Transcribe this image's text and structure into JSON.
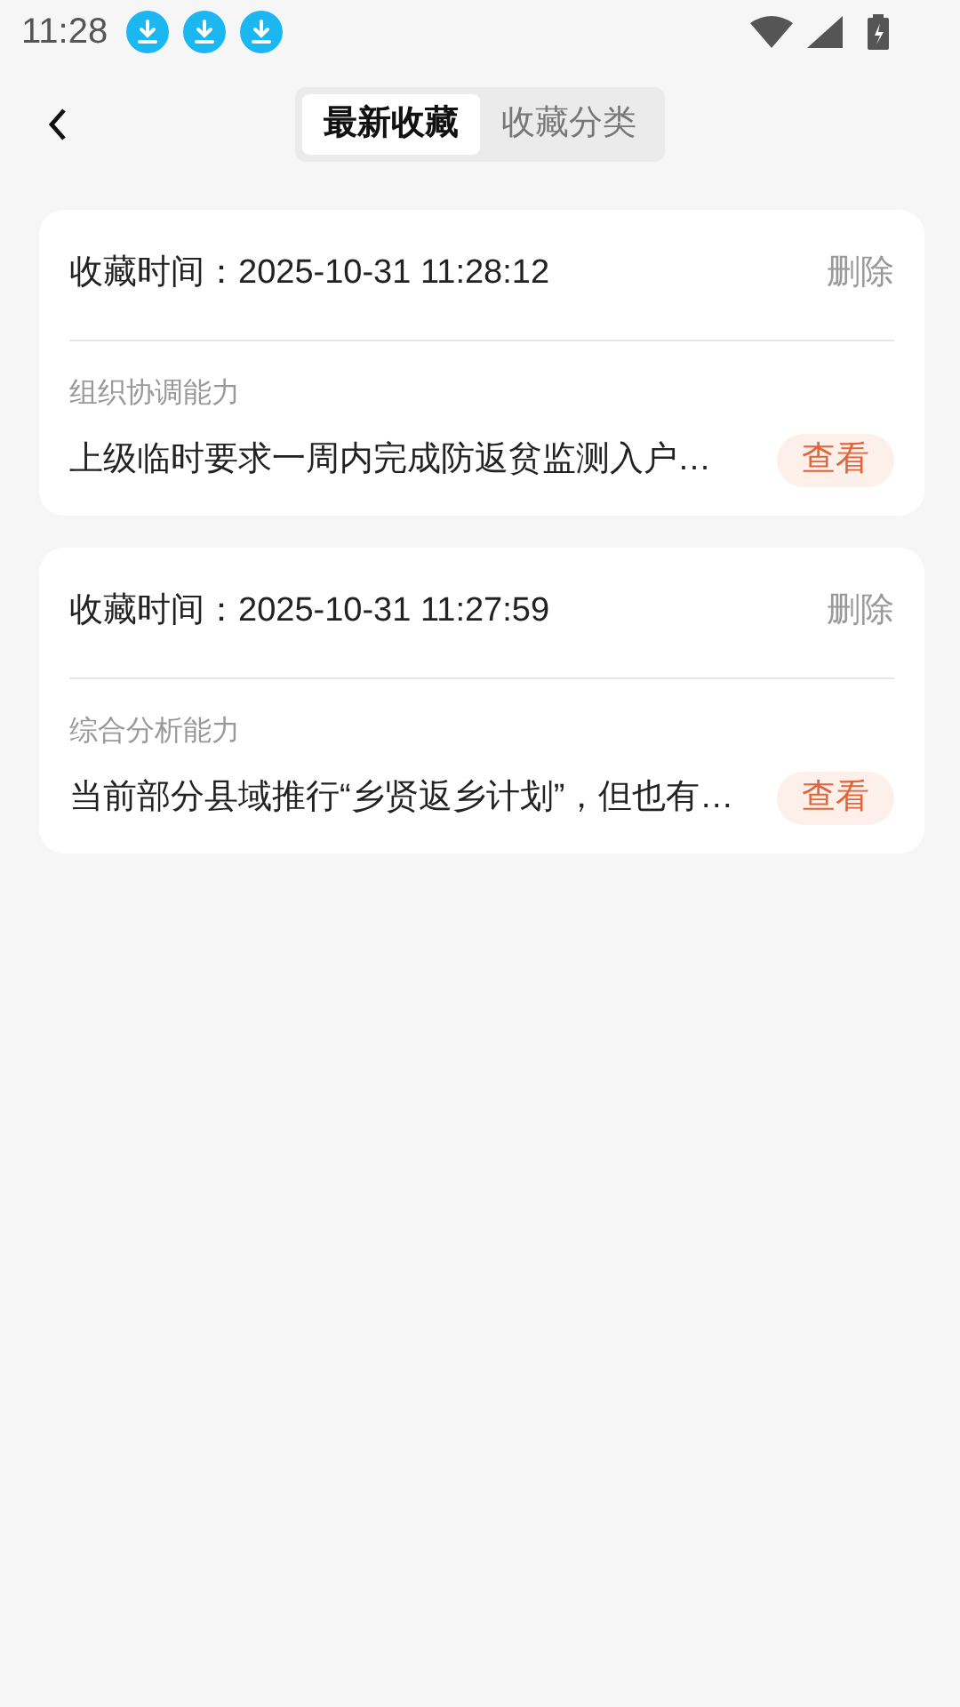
{
  "status_bar": {
    "time": "11:28",
    "notifications": [
      {
        "kind": "download"
      },
      {
        "kind": "download"
      },
      {
        "kind": "download"
      }
    ]
  },
  "tabs": [
    {
      "label": "最新收藏",
      "selected": true
    },
    {
      "label": "收藏分类",
      "selected": false
    }
  ],
  "favorites": [
    {
      "time_label": "收藏时间：2025-10-31 11:28:12",
      "delete": "删除",
      "category": "组织协调能力",
      "excerpt": "上级临时要求一周内完成防返贫监测入户…",
      "view": "查看"
    },
    {
      "time_label": "收藏时间：2025-10-31 11:27:59",
      "delete": "删除",
      "category": "综合分析能力",
      "excerpt": "当前部分县域推行“乡贤返乡计划”，但也有…",
      "view": "查看"
    }
  ]
}
